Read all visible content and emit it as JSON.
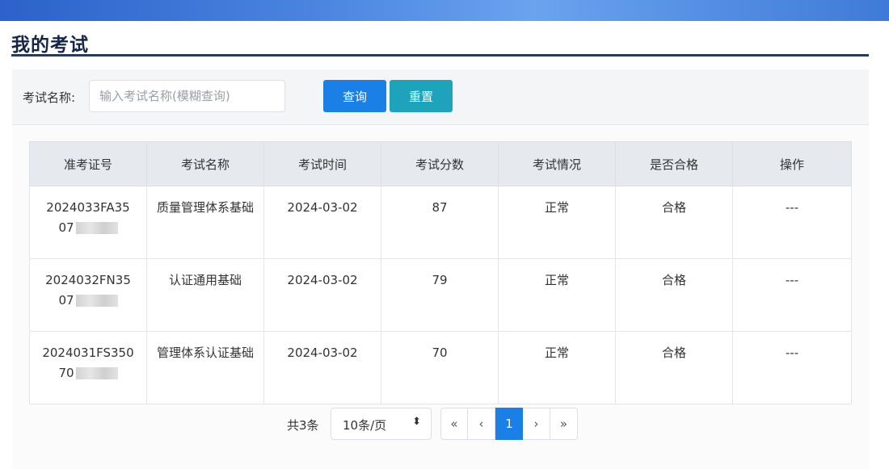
{
  "page": {
    "title": "我的考试"
  },
  "search": {
    "label": "考试名称:",
    "placeholder": "输入考试名称(模糊查询)",
    "value": "",
    "query_button": "查询",
    "reset_button": "重置"
  },
  "table": {
    "headers": [
      "准考证号",
      "考试名称",
      "考试时间",
      "考试分数",
      "考试情况",
      "是否合格",
      "操作"
    ],
    "rows": [
      {
        "id_line1": "2024033FA35",
        "id_line2": "07",
        "name": "质量管理体系基础",
        "time": "2024-03-02",
        "score": "87",
        "status": "正常",
        "pass": "合格",
        "op": "---"
      },
      {
        "id_line1": "2024032FN35",
        "id_line2": "07",
        "name": "认证通用基础",
        "time": "2024-03-02",
        "score": "79",
        "status": "正常",
        "pass": "合格",
        "op": "---"
      },
      {
        "id_line1": "2024031FS350",
        "id_line2": "70",
        "name": "管理体系认证基础",
        "time": "2024-03-02",
        "score": "70",
        "status": "正常",
        "pass": "合格",
        "op": "---"
      }
    ]
  },
  "pagination": {
    "total": "共3条",
    "page_size": "10条/页",
    "first": "«",
    "prev": "‹",
    "current": "1",
    "next": "›",
    "last": "»"
  },
  "colors": {
    "primary": "#1a80e6",
    "reset": "#1fa2bb",
    "title": "#15254a",
    "banner": "#4a84e0"
  }
}
